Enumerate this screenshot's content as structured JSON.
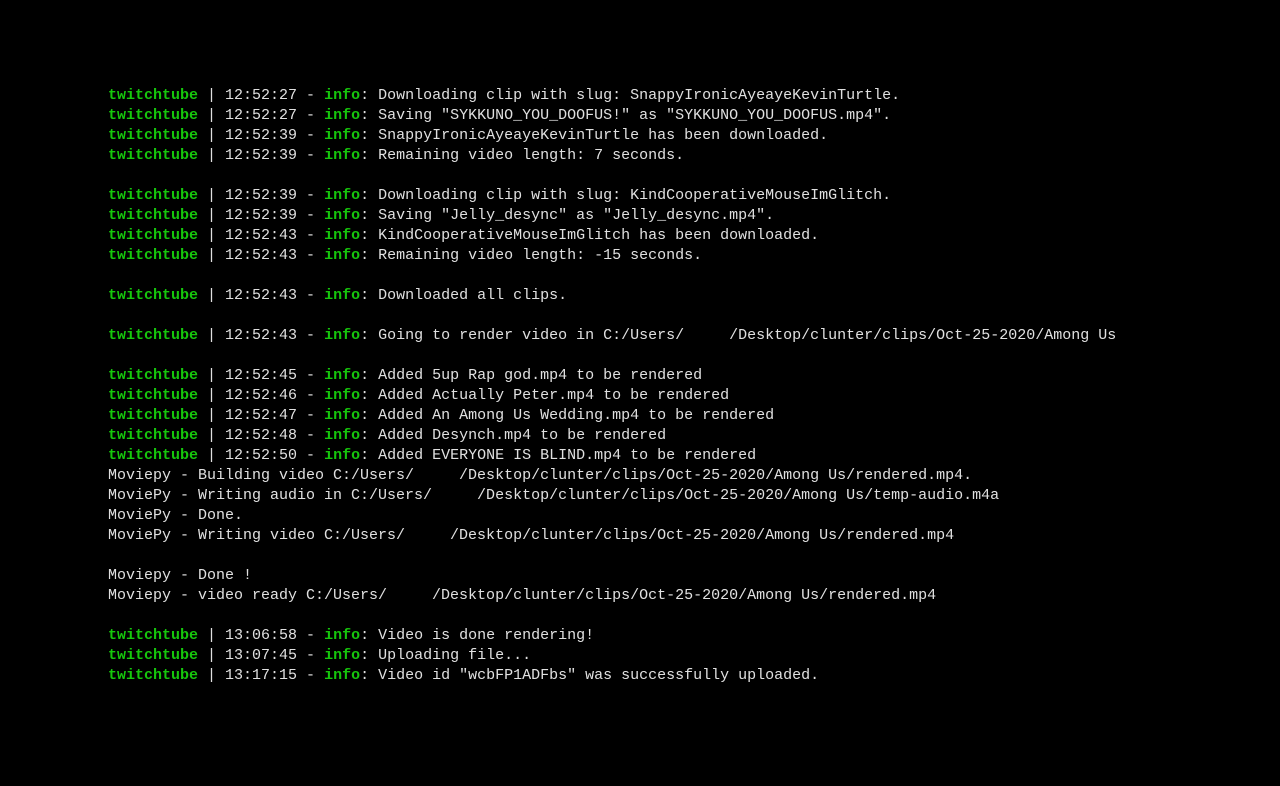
{
  "tag": "twitchtube",
  "level": "info",
  "lines": [
    {
      "type": "log",
      "time": "12:52:27",
      "msg": "Downloading clip with slug: SnappyIronicAyeayeKevinTurtle."
    },
    {
      "type": "log",
      "time": "12:52:27",
      "msg": "Saving \"SYKKUNO_YOU_DOOFUS!\" as \"SYKKUNO_YOU_DOOFUS.mp4\"."
    },
    {
      "type": "log",
      "time": "12:52:39",
      "msg": "SnappyIronicAyeayeKevinTurtle has been downloaded."
    },
    {
      "type": "log",
      "time": "12:52:39",
      "msg": "Remaining video length: 7 seconds."
    },
    {
      "type": "blank"
    },
    {
      "type": "log",
      "time": "12:52:39",
      "msg": "Downloading clip with slug: KindCooperativeMouseImGlitch."
    },
    {
      "type": "log",
      "time": "12:52:39",
      "msg": "Saving \"Jelly_desync\" as \"Jelly_desync.mp4\"."
    },
    {
      "type": "log",
      "time": "12:52:43",
      "msg": "KindCooperativeMouseImGlitch has been downloaded."
    },
    {
      "type": "log",
      "time": "12:52:43",
      "msg": "Remaining video length: -15 seconds."
    },
    {
      "type": "blank"
    },
    {
      "type": "log",
      "time": "12:52:43",
      "msg": "Downloaded all clips."
    },
    {
      "type": "blank"
    },
    {
      "type": "log",
      "time": "12:52:43",
      "msg": "Going to render video in C:/Users/     /Desktop/clunter/clips/Oct-25-2020/Among Us"
    },
    {
      "type": "blank"
    },
    {
      "type": "log",
      "time": "12:52:45",
      "msg": "Added 5up Rap god.mp4 to be rendered"
    },
    {
      "type": "log",
      "time": "12:52:46",
      "msg": "Added Actually Peter.mp4 to be rendered"
    },
    {
      "type": "log",
      "time": "12:52:47",
      "msg": "Added An Among Us Wedding.mp4 to be rendered"
    },
    {
      "type": "log",
      "time": "12:52:48",
      "msg": "Added Desynch.mp4 to be rendered"
    },
    {
      "type": "log",
      "time": "12:52:50",
      "msg": "Added EVERYONE IS BLIND.mp4 to be rendered"
    },
    {
      "type": "plain",
      "text": "Moviepy - Building video C:/Users/     /Desktop/clunter/clips/Oct-25-2020/Among Us/rendered.mp4."
    },
    {
      "type": "plain",
      "text": "MoviePy - Writing audio in C:/Users/     /Desktop/clunter/clips/Oct-25-2020/Among Us/temp-audio.m4a"
    },
    {
      "type": "plain",
      "text": "MoviePy - Done."
    },
    {
      "type": "plain",
      "text": "MoviePy - Writing video C:/Users/     /Desktop/clunter/clips/Oct-25-2020/Among Us/rendered.mp4"
    },
    {
      "type": "blank"
    },
    {
      "type": "plain",
      "text": "Moviepy - Done !"
    },
    {
      "type": "plain",
      "text": "Moviepy - video ready C:/Users/     /Desktop/clunter/clips/Oct-25-2020/Among Us/rendered.mp4"
    },
    {
      "type": "blank"
    },
    {
      "type": "log",
      "time": "13:06:58",
      "msg": "Video is done rendering!"
    },
    {
      "type": "log",
      "time": "13:07:45",
      "msg": "Uploading file..."
    },
    {
      "type": "log",
      "time": "13:17:15",
      "msg": "Video id \"wcbFP1ADFbs\" was successfully uploaded."
    }
  ]
}
